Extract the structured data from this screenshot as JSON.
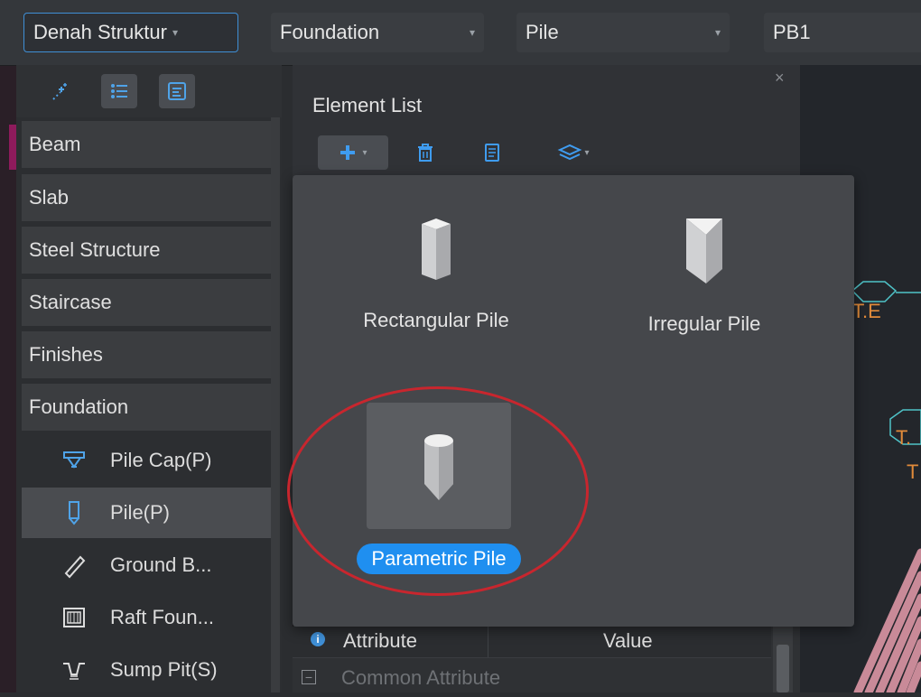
{
  "topbar": {
    "floor": "Denah Struktur",
    "category": "Foundation",
    "type": "Pile",
    "name": "PB1"
  },
  "sidebar": {
    "categories": [
      "Beam",
      "Slab",
      "Steel Structure",
      "Staircase",
      "Finishes",
      "Foundation"
    ],
    "items": [
      {
        "label": "Pile Cap(P)",
        "icon": "pile-cap-icon"
      },
      {
        "label": "Pile(P)",
        "icon": "pile-icon",
        "selected": true
      },
      {
        "label": "Ground B...",
        "icon": "ground-beam-icon"
      },
      {
        "label": "Raft Foun...",
        "icon": "raft-foundation-icon"
      },
      {
        "label": "Sump Pit(S)",
        "icon": "sump-pit-icon"
      }
    ]
  },
  "panel": {
    "title": "Element List",
    "close": "×"
  },
  "popup": {
    "options": [
      "Rectangular Pile",
      "Irregular Pile",
      "Parametric Pile"
    ],
    "highlighted": "Parametric Pile"
  },
  "attributes": {
    "col_attribute": "Attribute",
    "col_value": "Value",
    "group": "Common Attribute",
    "info": "i",
    "collapse": "−"
  },
  "canvas": {
    "labels": [
      "T.E",
      "T.",
      "T"
    ]
  },
  "colors": {
    "accent_blue": "#1f8ff0",
    "highlight_circle": "#c8262e",
    "canvas_label": "#e08a3a",
    "canvas_line": "#4fc3c8",
    "rebar": "#c98a98"
  }
}
